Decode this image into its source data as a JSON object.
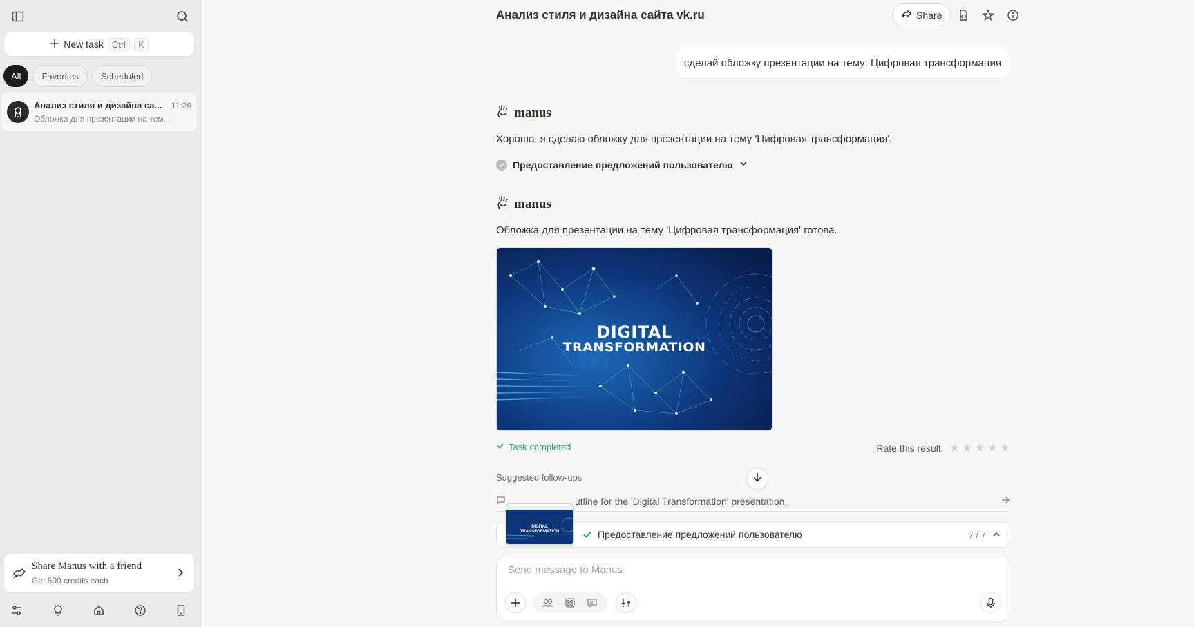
{
  "sidebar": {
    "new_task_label": "New task",
    "shortcut_ctrl": "Ctrl",
    "shortcut_key": "K",
    "filters": [
      "All",
      "Favorites",
      "Scheduled"
    ],
    "active_filter": "All",
    "tasks": [
      {
        "title": "Анализ стиля и дизайна са...",
        "time": "11:26",
        "subtitle": "Обложка для презентации на тем..."
      }
    ],
    "share_card": {
      "title": "Share Manus with a friend",
      "subtitle": "Get 500 credits each"
    },
    "bottom_icons": [
      "settings-sliders-icon",
      "lightbulb-icon",
      "home-icon",
      "help-icon",
      "mobile-icon"
    ]
  },
  "header": {
    "title": "Анализ стиля и дизайна сайта vk.ru",
    "share_label": "Share",
    "icons": [
      "file-icon",
      "star-icon",
      "info-icon"
    ]
  },
  "conversation": {
    "user_message": "сделай обложку презентации на тему: Цифровая трансформация",
    "agent_name": "manus",
    "agent_reply_1": "Хорошо, я сделаю обложку для презентации на тему 'Цифровая трансформация'.",
    "step_label": "Предоставление предложений пользователю",
    "agent_reply_2": "Обложка для презентации на тему 'Цифровая трансформация' готова.",
    "cover_title_line1": "DIGITAL",
    "cover_title_line2": "TRANSFORMATION",
    "status": "Task completed",
    "rate_label": "Rate this result",
    "rating": 0,
    "followups_label": "Suggested follow-ups",
    "followup_text": "utline for the 'Digital Transformation' presentation."
  },
  "progress": {
    "label": "Предоставление предложений пользователю",
    "count": "7 / 7",
    "thumb_line1": "DIGITAL",
    "thumb_line2": "TRANSFORMATION"
  },
  "composer": {
    "placeholder": "Send message to Manus"
  },
  "colors": {
    "accent_green": "#25a36a",
    "sidebar_bg": "#ebebeb",
    "main_bg": "#f8f8f7",
    "cover_bg": "#0a2a63"
  }
}
